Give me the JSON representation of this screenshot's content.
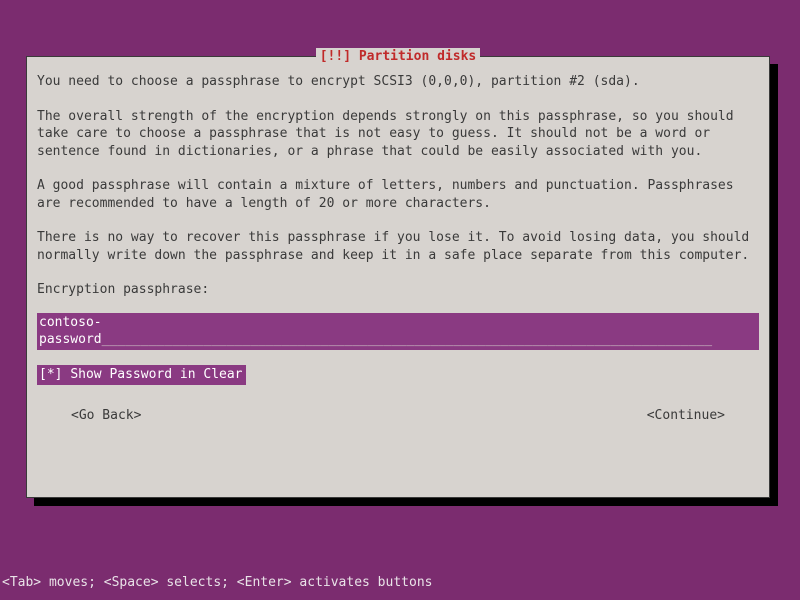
{
  "title": "[!!] Partition disks",
  "paragraphs": {
    "p1": "You need to choose a passphrase to encrypt SCSI3 (0,0,0), partition #2 (sda).",
    "p2": "The overall strength of the encryption depends strongly on this passphrase, so you should take care to choose a passphrase that is not easy to guess. It should not be a word or sentence found in dictionaries, or a phrase that could be easily associated with you.",
    "p3": "A good passphrase will contain a mixture of letters, numbers and punctuation. Passphrases are recommended to have a length of 20 or more characters.",
    "p4": "There is no way to recover this passphrase if you lose it. To avoid losing data, you should normally write down the passphrase and keep it in a safe place separate from this computer."
  },
  "field": {
    "label": "Encryption passphrase:",
    "value": "contoso-password",
    "filler": "______________________________________________________________________________"
  },
  "checkbox": {
    "state": "[*]",
    "label": "Show Password in Clear"
  },
  "nav": {
    "back": "<Go Back>",
    "continue": "<Continue>"
  },
  "footer": "<Tab> moves; <Space> selects; <Enter> activates buttons"
}
